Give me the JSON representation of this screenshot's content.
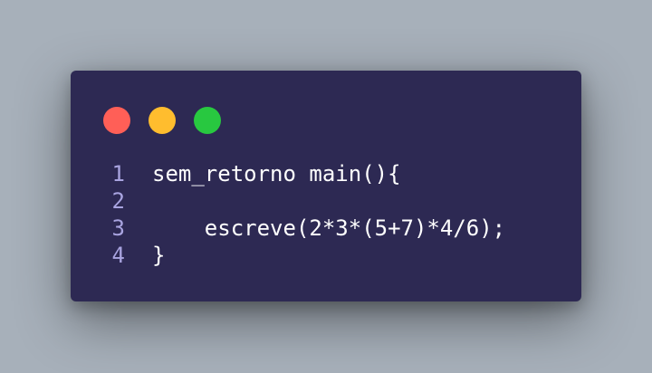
{
  "editor": {
    "colors": {
      "background": "#a7b0ba",
      "window": "#2d2953",
      "line_number": "#a9a4e0",
      "code_text": "#ffffff"
    },
    "window_controls": [
      {
        "name": "close-dot-icon",
        "color": "#ff5f57"
      },
      {
        "name": "minimize-dot-icon",
        "color": "#ffbd2e"
      },
      {
        "name": "maximize-dot-icon",
        "color": "#28c840"
      }
    ],
    "lines": [
      {
        "number": "1",
        "text": "sem_retorno main(){"
      },
      {
        "number": "2",
        "text": ""
      },
      {
        "number": "3",
        "text": "    escreve(2*3*(5+7)*4/6);"
      },
      {
        "number": "4",
        "text": "}"
      }
    ]
  }
}
